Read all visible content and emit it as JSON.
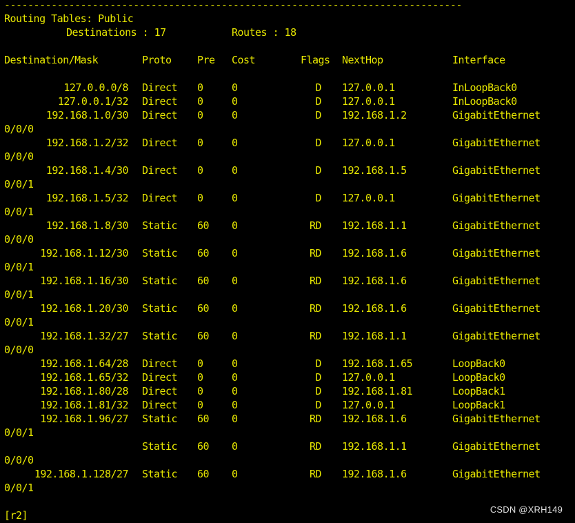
{
  "window": {
    "background": "#000000",
    "text_color": "#e6e600"
  },
  "header": {
    "separator": "------------------------------------------------------------------------------",
    "title": "Routing Tables: Public",
    "destinations_label": "Destinations : 17",
    "routes_label": "Routes : 18"
  },
  "columns": {
    "destination": "Destination/Mask",
    "proto": "Proto",
    "pre": "Pre",
    "cost": "Cost",
    "flags": "Flags",
    "nexthop": "NextHop",
    "interface": "Interface"
  },
  "routes": [
    {
      "dest": "127.0.0.0/8",
      "proto": "Direct",
      "pre": "0",
      "cost": "0",
      "flags": "D",
      "nexthop": "127.0.0.1",
      "iface": "InLoopBack0",
      "iface_cont": ""
    },
    {
      "dest": "127.0.0.1/32",
      "proto": "Direct",
      "pre": "0",
      "cost": "0",
      "flags": "D",
      "nexthop": "127.0.0.1",
      "iface": "InLoopBack0",
      "iface_cont": ""
    },
    {
      "dest": "192.168.1.0/30",
      "proto": "Direct",
      "pre": "0",
      "cost": "0",
      "flags": "D",
      "nexthop": "192.168.1.2",
      "iface": "GigabitEthernet",
      "iface_cont": "0/0/0"
    },
    {
      "dest": "192.168.1.2/32",
      "proto": "Direct",
      "pre": "0",
      "cost": "0",
      "flags": "D",
      "nexthop": "127.0.0.1",
      "iface": "GigabitEthernet",
      "iface_cont": "0/0/0"
    },
    {
      "dest": "192.168.1.4/30",
      "proto": "Direct",
      "pre": "0",
      "cost": "0",
      "flags": "D",
      "nexthop": "192.168.1.5",
      "iface": "GigabitEthernet",
      "iface_cont": "0/0/1"
    },
    {
      "dest": "192.168.1.5/32",
      "proto": "Direct",
      "pre": "0",
      "cost": "0",
      "flags": "D",
      "nexthop": "127.0.0.1",
      "iface": "GigabitEthernet",
      "iface_cont": "0/0/1"
    },
    {
      "dest": "192.168.1.8/30",
      "proto": "Static",
      "pre": "60",
      "cost": "0",
      "flags": "RD",
      "nexthop": "192.168.1.1",
      "iface": "GigabitEthernet",
      "iface_cont": "0/0/0"
    },
    {
      "dest": "192.168.1.12/30",
      "proto": "Static",
      "pre": "60",
      "cost": "0",
      "flags": "RD",
      "nexthop": "192.168.1.6",
      "iface": "GigabitEthernet",
      "iface_cont": "0/0/1"
    },
    {
      "dest": "192.168.1.16/30",
      "proto": "Static",
      "pre": "60",
      "cost": "0",
      "flags": "RD",
      "nexthop": "192.168.1.6",
      "iface": "GigabitEthernet",
      "iface_cont": "0/0/1"
    },
    {
      "dest": "192.168.1.20/30",
      "proto": "Static",
      "pre": "60",
      "cost": "0",
      "flags": "RD",
      "nexthop": "192.168.1.6",
      "iface": "GigabitEthernet",
      "iface_cont": "0/0/1"
    },
    {
      "dest": "192.168.1.32/27",
      "proto": "Static",
      "pre": "60",
      "cost": "0",
      "flags": "RD",
      "nexthop": "192.168.1.1",
      "iface": "GigabitEthernet",
      "iface_cont": "0/0/0"
    },
    {
      "dest": "192.168.1.64/28",
      "proto": "Direct",
      "pre": "0",
      "cost": "0",
      "flags": "D",
      "nexthop": "192.168.1.65",
      "iface": "LoopBack0",
      "iface_cont": ""
    },
    {
      "dest": "192.168.1.65/32",
      "proto": "Direct",
      "pre": "0",
      "cost": "0",
      "flags": "D",
      "nexthop": "127.0.0.1",
      "iface": "LoopBack0",
      "iface_cont": ""
    },
    {
      "dest": "192.168.1.80/28",
      "proto": "Direct",
      "pre": "0",
      "cost": "0",
      "flags": "D",
      "nexthop": "192.168.1.81",
      "iface": "LoopBack1",
      "iface_cont": ""
    },
    {
      "dest": "192.168.1.81/32",
      "proto": "Direct",
      "pre": "0",
      "cost": "0",
      "flags": "D",
      "nexthop": "127.0.0.1",
      "iface": "LoopBack1",
      "iface_cont": ""
    },
    {
      "dest": "192.168.1.96/27",
      "proto": "Static",
      "pre": "60",
      "cost": "0",
      "flags": "RD",
      "nexthop": "192.168.1.6",
      "iface": "GigabitEthernet",
      "iface_cont": "0/0/1"
    },
    {
      "dest": "",
      "proto": "Static",
      "pre": "60",
      "cost": "0",
      "flags": "RD",
      "nexthop": "192.168.1.1",
      "iface": "GigabitEthernet",
      "iface_cont": "0/0/0"
    },
    {
      "dest": "192.168.1.128/27",
      "proto": "Static",
      "pre": "60",
      "cost": "0",
      "flags": "RD",
      "nexthop": "192.168.1.6",
      "iface": "GigabitEthernet",
      "iface_cont": "0/0/1"
    }
  ],
  "prompt": "[r2]",
  "watermark": "CSDN @XRH149"
}
